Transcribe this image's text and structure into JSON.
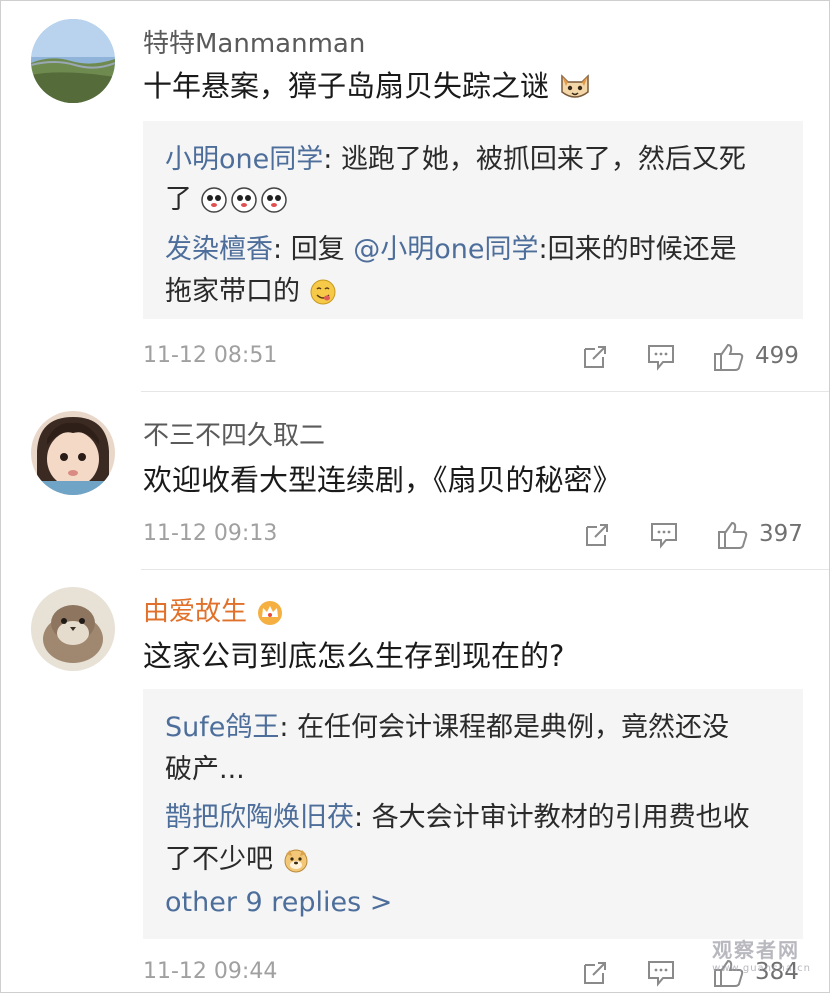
{
  "comments": [
    {
      "username": "特特Manmanman",
      "text": "十年悬案，獐子岛扇贝失踪之谜",
      "replies": [
        {
          "name": "小明one同学",
          "sep": ": ",
          "line1": "逃跑了她，被抓回来了，然后又死",
          "line2": "了"
        },
        {
          "name": "发染檀香",
          "sep": ": ",
          "prefix": "回复 ",
          "mention": "@小明one同学",
          "line1": ":回来的时候还是",
          "line2": "拖家带口的"
        }
      ],
      "time": "11-12 08:51",
      "likes": "499"
    },
    {
      "username": "不三不四久取二",
      "text": "欢迎收看大型连续剧，《扇贝的秘密》",
      "time": "11-12 09:13",
      "likes": "397"
    },
    {
      "username": "由爱故生",
      "text": "这家公司到底怎么生存到现在的?",
      "replies": [
        {
          "name": "Sufe鸽王",
          "sep": ": ",
          "line1": "在任何会计课程都是典例，竟然还没",
          "line2": "破产..."
        },
        {
          "name": "鹊把欣陶焕旧茯",
          "sep": ": ",
          "line1": "各大会计审计教材的引用费也收",
          "line2": "了不少吧"
        }
      ],
      "more_replies": "other 9 replies >",
      "time": "11-12 09:44",
      "likes": "384"
    }
  ],
  "icons": {
    "share": "share-icon",
    "comment": "comment-icon",
    "like": "thumbs-up-icon"
  },
  "watermark": {
    "main": "观察者网",
    "sub": "www.guancha.cn"
  },
  "colors": {
    "name_link": "#4d6e9a",
    "vip_name": "#e0702a",
    "meta": "#a0a0a0",
    "reply_bg": "#f5f5f6"
  }
}
